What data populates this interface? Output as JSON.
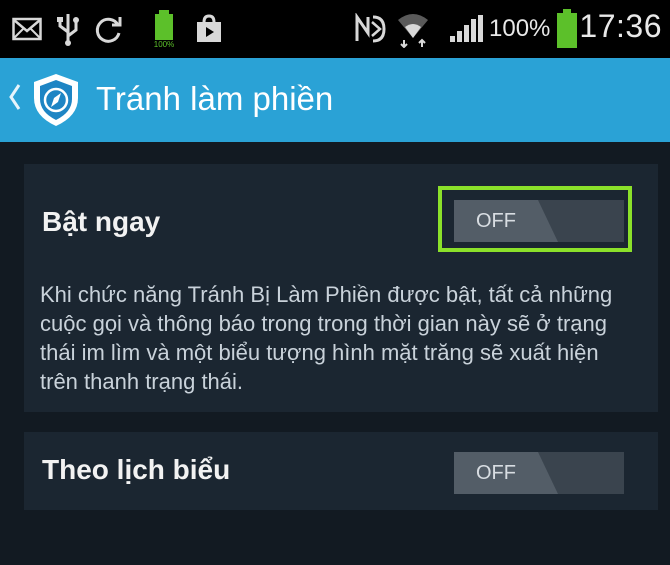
{
  "status_bar": {
    "time": "17:36",
    "battery_percent": "100%",
    "icons": [
      "mail-icon",
      "usb-icon",
      "sync-icon",
      "battery-full-small-icon",
      "shopping-bag-icon",
      "nfc-icon",
      "wifi-icon",
      "signal-icon",
      "battery-icon"
    ]
  },
  "action_bar": {
    "title": "Tránh làm phiền",
    "back_icon": "chevron-left-icon",
    "logo_icon": "shield-compass-icon",
    "color": "#2aa2d6"
  },
  "settings": [
    {
      "label": "Bật ngay",
      "toggle": "OFF",
      "description": "Khi chức năng Tránh Bị Làm Phiền được bật, tất cả những cuộc gọi và thông báo trong trong thời gian này sẽ ở trạng thái im lìm và một biểu tượng hình mặt trăng sẽ xuất hiện trên thanh trạng thái.",
      "highlighted": true
    },
    {
      "label": "Theo lịch biểu",
      "toggle": "OFF"
    }
  ],
  "colors": {
    "highlight": "#8be12a",
    "background": "#121a22",
    "card": "#1b2631"
  }
}
